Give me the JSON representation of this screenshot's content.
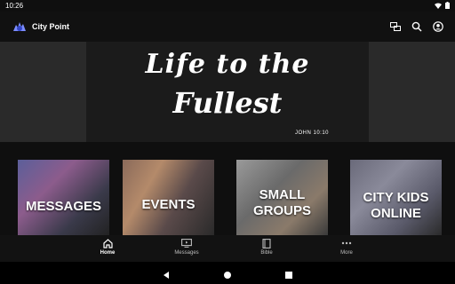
{
  "status": {
    "time": "10:26"
  },
  "app": {
    "title": "City Point"
  },
  "hero": {
    "line1": "Life to the",
    "line2": "Fullest",
    "reference": "JOHN 10:10"
  },
  "cards": [
    {
      "label": "MESSAGES"
    },
    {
      "label": "EVENTS"
    },
    {
      "label": "SMALL GROUPS"
    },
    {
      "label": "CITY KIDS ONLINE"
    }
  ],
  "nav": [
    {
      "label": "Home",
      "icon": "home-icon"
    },
    {
      "label": "Messages",
      "icon": "tv-icon"
    },
    {
      "label": "Bible",
      "icon": "book-icon"
    },
    {
      "label": "More",
      "icon": "more-dots-icon"
    }
  ],
  "colors": {
    "background": "#101010",
    "appbar": "#111111",
    "text": "#ffffff",
    "muted": "#bdbdbd"
  }
}
